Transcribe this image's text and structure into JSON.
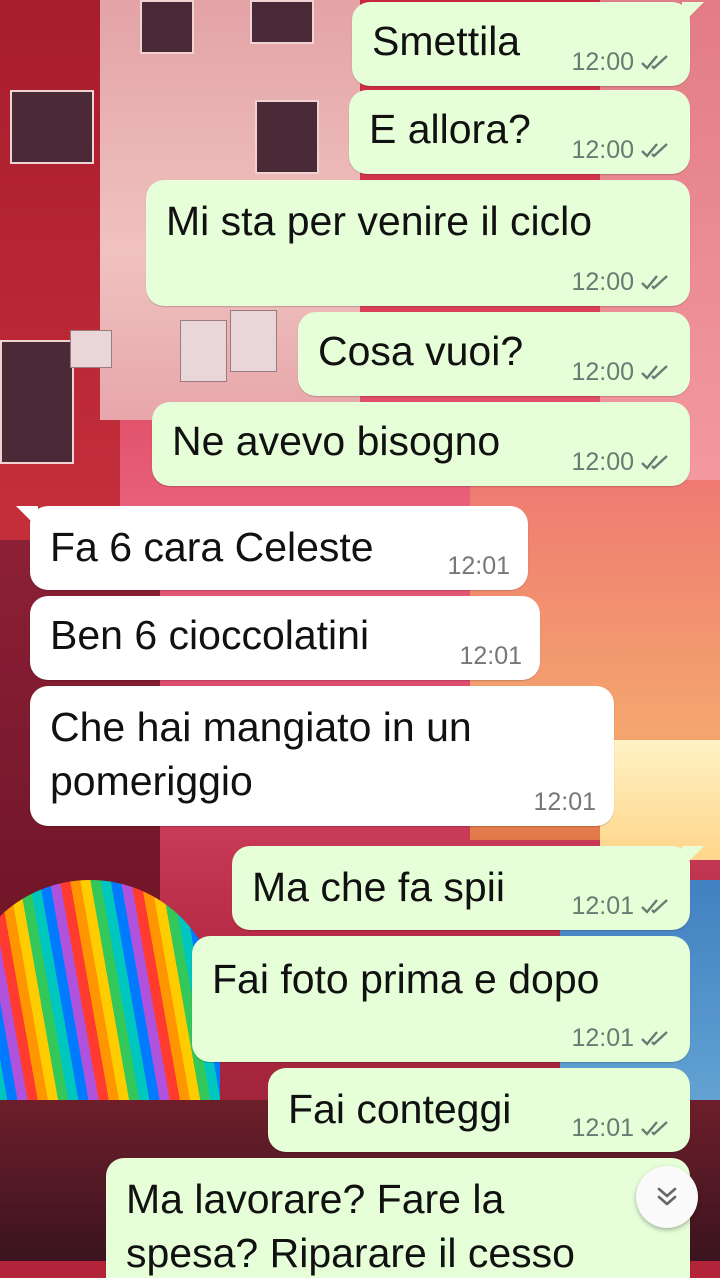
{
  "messages": [
    {
      "id": "m1",
      "dir": "out",
      "text": "Smettila",
      "time": "12:00",
      "ticks": "read-ticks-icon"
    },
    {
      "id": "m2",
      "dir": "out",
      "text": "E allora?",
      "time": "12:00",
      "ticks": "read-ticks-icon"
    },
    {
      "id": "m3",
      "dir": "out",
      "text": "Mi sta per venire il ciclo",
      "time": "12:00",
      "ticks": "read-ticks-icon"
    },
    {
      "id": "m4",
      "dir": "out",
      "text": "Cosa vuoi?",
      "time": "12:00",
      "ticks": "read-ticks-icon"
    },
    {
      "id": "m5",
      "dir": "out",
      "text": "Ne avevo bisogno",
      "time": "12:00",
      "ticks": "read-ticks-icon"
    },
    {
      "id": "m6",
      "dir": "in",
      "text": "Fa 6 cara Celeste",
      "time": "12:01"
    },
    {
      "id": "m7",
      "dir": "in",
      "text": "Ben 6 cioccolatini",
      "time": "12:01"
    },
    {
      "id": "m8",
      "dir": "in",
      "text_line1": "Che hai mangiato in un",
      "text_line2": "pomeriggio",
      "time": "12:01"
    },
    {
      "id": "m9",
      "dir": "out",
      "text": "Ma che fa spii",
      "time": "12:01",
      "ticks": "read-ticks-icon"
    },
    {
      "id": "m10",
      "dir": "out",
      "text": "Fai foto prima e dopo",
      "time": "12:01",
      "ticks": "read-ticks-icon"
    },
    {
      "id": "m11",
      "dir": "out",
      "text": "Fai conteggi",
      "time": "12:01",
      "ticks": "read-ticks-icon"
    },
    {
      "id": "m12",
      "dir": "out",
      "text_line1": "Ma lavorare? Fare la",
      "text_line2": "spesa? Riparare il cesso"
    }
  ],
  "colors": {
    "outgoing": "#e6ffd8",
    "incoming": "#ffffff",
    "ticks": "#6b7a72"
  },
  "scroll_button_icon": "double-chevron-down-icon"
}
